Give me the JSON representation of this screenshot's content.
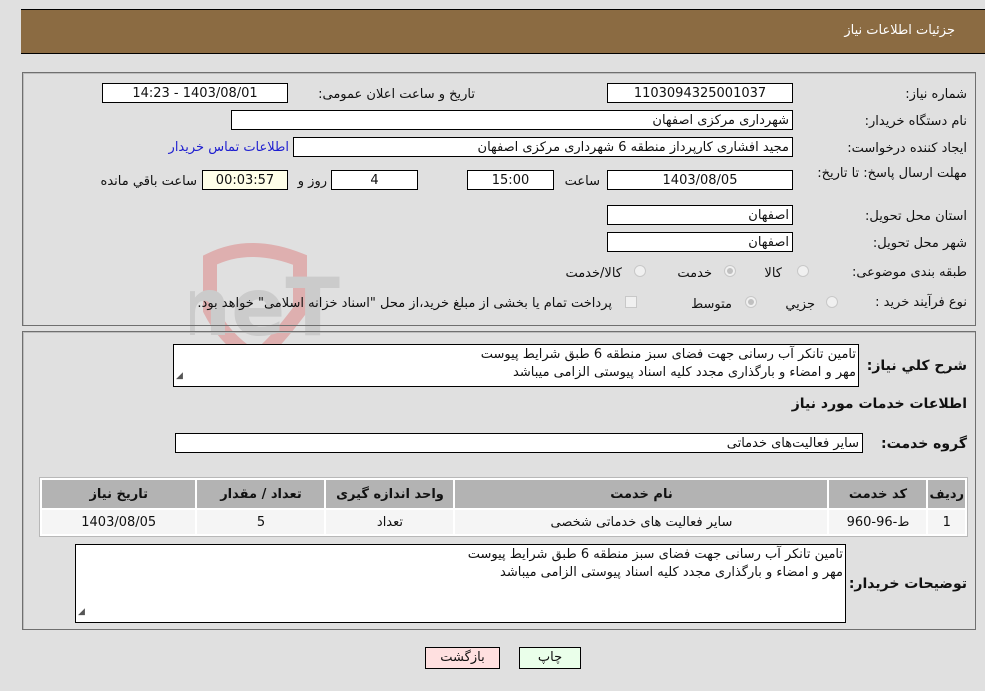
{
  "header": {
    "title": "جزئیات اطلاعات نیاز"
  },
  "fields": {
    "need_number": {
      "label": "شماره نیاز:",
      "value": "1103094325001037"
    },
    "announce_datetime": {
      "label": "تاریخ و ساعت اعلان عمومی:",
      "value": "1403/08/01 - 14:23"
    },
    "buyer_org": {
      "label": "نام دستگاه خریدار:",
      "value": "شهرداری مرکزی اصفهان"
    },
    "requester": {
      "label": "ایجاد کننده درخواست:",
      "value": "مجید افشاری کارپرداز منطقه 6 شهرداری مرکزی اصفهان"
    },
    "contact_link": "اطلاعات تماس خریدار",
    "deadline": {
      "label": "مهلت ارسال پاسخ: تا تاریخ:",
      "date": "1403/08/05",
      "time_label": "ساعت",
      "time": "15:00",
      "days": "4",
      "days_label": "روز و",
      "remaining": "00:03:57",
      "remaining_label": "ساعت باقي مانده"
    },
    "province": {
      "label": "استان محل تحویل:",
      "value": "اصفهان"
    },
    "city": {
      "label": "شهر محل تحویل:",
      "value": "اصفهان"
    },
    "category": {
      "label": "طبقه بندی موضوعی:",
      "options": [
        "کالا",
        "خدمت",
        "کالا/خدمت"
      ],
      "selected": "خدمت"
    },
    "purchase_type": {
      "label": "نوع فرآیند خرید :",
      "options": [
        "جزيي",
        "متوسط"
      ],
      "selected": "متوسط",
      "treasury_note": "پرداخت تمام یا بخشی از مبلغ خرید،از محل \"اسناد خزانه اسلامی\" خواهد بود."
    }
  },
  "description": {
    "label": "شرح کلي نياز:",
    "lines": [
      "تامین تانکر آب رسانی جهت فضای سبز منطقه 6 طبق شرایط پیوست",
      "مهر و امضاء و بارگذاری مجدد کلیه اسناد پیوستی الزامی میباشد"
    ]
  },
  "services_section": {
    "title": "اطلاعات خدمات مورد نياز",
    "group_label": "گروه خدمت:",
    "group_value": "سایر فعالیت‌های خدماتی"
  },
  "table": {
    "headers": [
      "رديف",
      "کد خدمت",
      "نام خدمت",
      "واحد اندازه گيری",
      "تعداد / مقدار",
      "تاريخ نياز"
    ],
    "rows": [
      [
        "1",
        "ط-96-960",
        "سایر فعالیت های خدماتی شخصی",
        "تعداد",
        "5",
        "1403/08/05"
      ]
    ]
  },
  "buyer_notes": {
    "label": "توضيحات خريدار:",
    "lines": [
      "تامین تانکر آب رسانی جهت فضای سبز منطقه 6 طبق شرایط پیوست",
      "مهر و امضاء و بارگذاری مجدد کلیه اسناد پیوستی الزامی میباشد"
    ]
  },
  "buttons": {
    "print": "چاپ",
    "back": "بازگشت"
  },
  "colors": {
    "header_bg": "#8b6b42",
    "print_bg": "#eaffea",
    "back_bg": "#ffe0e0",
    "link": "#1f1fd0"
  }
}
